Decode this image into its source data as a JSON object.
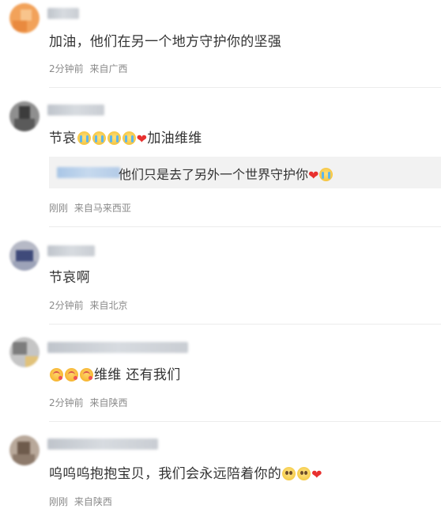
{
  "comments": [
    {
      "text": "加油，他们在另一个地方守护你的坚强",
      "time": "2分钟前",
      "location": "来自广西"
    },
    {
      "text_prefix": "节哀",
      "text_suffix": "加油维维",
      "emojis": [
        "crying-face-icon",
        "crying-face-icon",
        "crying-face-icon",
        "crying-face-icon",
        "red-heart-icon"
      ],
      "reply": {
        "text": "他们只是去了另外一个世界守护你",
        "emojis": [
          "red-heart-icon",
          "crying-face-icon"
        ]
      },
      "time": "刚刚",
      "location": "来自马来西亚"
    },
    {
      "text": "节哀啊",
      "time": "2分钟前",
      "location": "来自北京"
    },
    {
      "text_suffix": "维维 还有我们",
      "emojis": [
        "kiss-face-icon",
        "kiss-face-icon",
        "kiss-face-icon"
      ],
      "time": "2分钟前",
      "location": "来自陕西"
    },
    {
      "text_prefix": "呜呜呜抱抱宝贝，我们会永远陪着你的",
      "emojis": [
        "pleading-face-icon",
        "pleading-face-icon",
        "red-heart-icon"
      ],
      "time": "刚刚",
      "location": "来自陕西"
    }
  ],
  "colors": {
    "text": "#333333",
    "meta": "#8a8a8a",
    "heart": "#e8312f",
    "reply_bg": "#f2f2f2"
  }
}
